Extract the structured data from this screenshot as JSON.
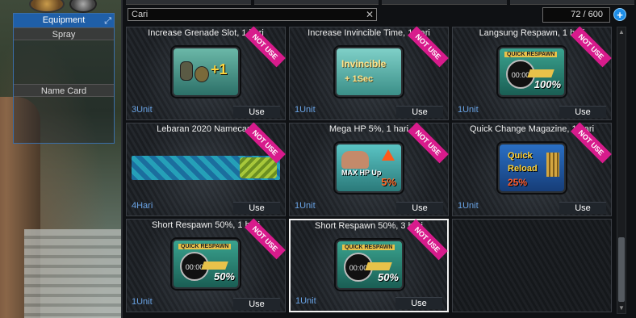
{
  "equipment": {
    "title": "Equipment",
    "slots": [
      "Spray",
      "Name Card"
    ]
  },
  "inventory": {
    "search_value": "Cari",
    "count": "72 / 600",
    "add_label": "+",
    "items": [
      {
        "title": "Increase Grenade Slot, 1 hari",
        "qty": "3Unit",
        "use": "Use",
        "tag": "NOT USE",
        "icon": "grenade-slot-icon",
        "icon_text": "+1"
      },
      {
        "title": "Increase Invincible Time, 1 hari",
        "qty": "1Unit",
        "use": "Use",
        "tag": "NOT USE",
        "icon": "invincible-icon",
        "icon_text": "Invincible",
        "icon_text2": "+ 1Sec"
      },
      {
        "title": "Langsung Respawn, 1 hari",
        "qty": "1Unit",
        "use": "Use",
        "tag": "NOT USE",
        "icon": "quick-respawn-icon",
        "icon_label": "QUICK RESPAWN",
        "icon_time": "00:00",
        "icon_pct": "100%"
      },
      {
        "title": "Lebaran 2020 Namecard",
        "qty": "4Hari",
        "use": "Use",
        "tag": "NOT USE",
        "icon": "namecard-icon"
      },
      {
        "title": "Mega HP 5%, 1 hari",
        "qty": "1Unit",
        "use": "Use",
        "tag": "NOT USE",
        "icon": "max-hp-icon",
        "icon_text": "MAX HP Up",
        "icon_pct": "5%"
      },
      {
        "title": "Quick Change Magazine, 1 hari",
        "qty": "1Unit",
        "use": "Use",
        "tag": "NOT USE",
        "icon": "quick-reload-icon",
        "icon_text": "Quick",
        "icon_text2": "Reload",
        "icon_pct": "25%"
      },
      {
        "title": "Short Respawn 50%, 1 hari",
        "qty": "1Unit",
        "use": "Use",
        "tag": "NOT USE",
        "icon": "quick-respawn-icon",
        "icon_label": "QUICK RESPAWN",
        "icon_time": "00:00",
        "icon_pct": "50%"
      },
      {
        "title": "Short Respawn 50%, 3 hari",
        "qty": "1Unit",
        "use": "Use",
        "tag": "NOT USE",
        "icon": "quick-respawn-icon",
        "icon_label": "QUICK RESPAWN",
        "icon_time": "00:00",
        "icon_pct": "50%"
      }
    ]
  },
  "colors": {
    "accent": "#1f5fa8",
    "tag": "#d81b8c",
    "qty": "#6aa4e6"
  }
}
